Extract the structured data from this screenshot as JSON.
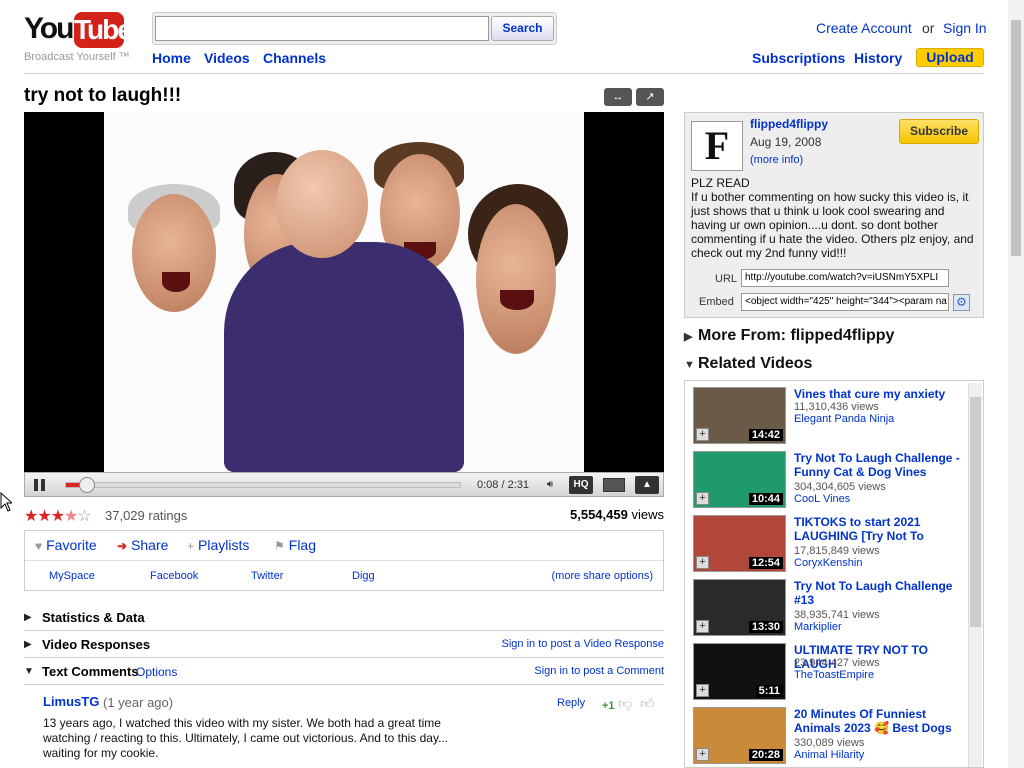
{
  "header": {
    "logo_you": "You",
    "logo_tube": "Tube",
    "tagline": "Broadcast Yourself ™",
    "search_button": "Search",
    "search_value": "",
    "nav": [
      "Home",
      "Videos",
      "Channels"
    ],
    "create_account": "Create Account",
    "or": "or",
    "sign_in": "Sign In",
    "subscriptions": "Subscriptions",
    "history": "History",
    "upload": "Upload"
  },
  "video": {
    "title": "try not to laugh!!!",
    "time": "0:08 / 2:31",
    "progress_fraction": 0.053,
    "hq": "HQ",
    "rating_stars": 3.5,
    "ratings": "37,029 ratings",
    "views_number": "5,554,459",
    "views_suffix": "views"
  },
  "actions": {
    "favorite": "Favorite",
    "share": "Share",
    "playlists": "Playlists",
    "flag": "Flag",
    "share_links": [
      "MySpace",
      "Facebook",
      "Twitter",
      "Digg"
    ],
    "more_share": "(more share options)"
  },
  "sections": {
    "stats": "Statistics & Data",
    "responses": "Video Responses",
    "responses_link": "Sign in to post a Video Response",
    "comments": "Text Comments",
    "comments_options": "Options",
    "comments_link": "Sign in to post a Comment"
  },
  "comment": {
    "author": "LimusTG",
    "age": "(1 year ago)",
    "reply": "Reply",
    "score": "+1",
    "text": "13 years ago, I watched this video with my sister. We both had a great time watching / reacting to this. Ultimately, I came out victorious. And to this day... waiting for my cookie."
  },
  "channel": {
    "avatar_letter": "F",
    "name": "flipped4flippy",
    "date": "Aug 19, 2008",
    "more_info": "(more info)",
    "subscribe": "Subscribe",
    "description": "PLZ READ\nIf u bother commenting on how sucky this video is, it just shows that u think u look cool swearing and having ur own opinion....u dont. so dont bother commenting if u hate the video. Others plz enjoy, and check out my 2nd funny vid!!!",
    "url_label": "URL",
    "url_value": "http://youtube.com/watch?v=iUSNmY5XPLI",
    "embed_label": "Embed",
    "embed_value": "<object width=\"425\" height=\"344\"><param na"
  },
  "right": {
    "more_from": "More From: flipped4flippy",
    "related": "Related Videos"
  },
  "related_videos": [
    {
      "title": "Vines that cure my anxiety",
      "views": "11,310,436 views",
      "channel": "Elegant Panda Ninja",
      "duration": "14:42",
      "color": "#6b5a48"
    },
    {
      "title": "Try Not To Laugh Challenge - Funny Cat & Dog Vines",
      "views": "304,304,605 views",
      "channel": "CooL Vines",
      "duration": "10:44",
      "color": "#1f9a6a"
    },
    {
      "title": "TIKTOKS to start 2021 LAUGHING [Try Not To",
      "views": "17,815,849 views",
      "channel": "CoryxKenshin",
      "duration": "12:54",
      "color": "#b0473a"
    },
    {
      "title": "Try Not To Laugh Challenge #13",
      "views": "38,935,741 views",
      "channel": "Markiplier",
      "duration": "13:30",
      "color": "#2a2a2a"
    },
    {
      "title": "ULTIMATE TRY NOT TO LAUGH",
      "views": "23,944,427 views",
      "channel": "TheToastEmpire",
      "duration": "5:11",
      "color": "#111111"
    },
    {
      "title": "20 Minutes Of Funniest Animals 2023 🥰 Best Dogs",
      "views": "330,089 views",
      "channel": "Animal Hilarity",
      "duration": "20:28",
      "color": "#c98a3a"
    }
  ],
  "colors": {
    "link": "#0033cc",
    "brand_red": "#d2221a",
    "upload_yellow": "#ffcc00"
  }
}
